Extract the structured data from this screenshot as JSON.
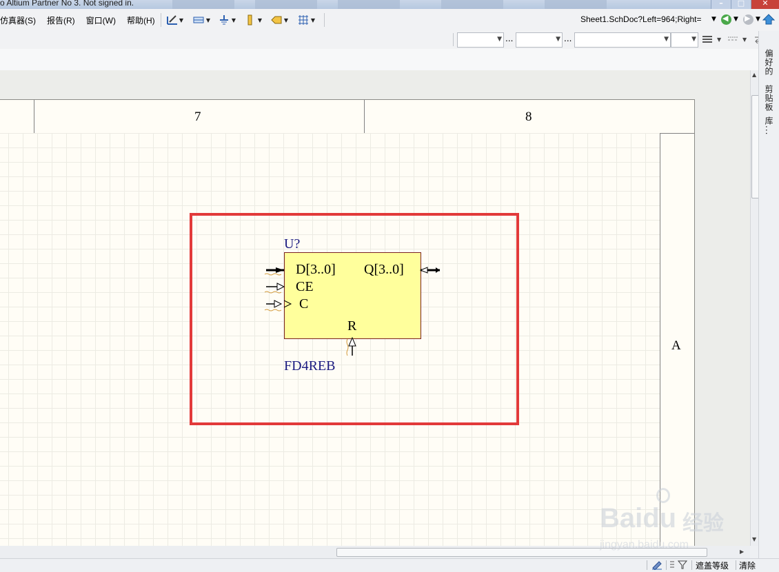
{
  "window": {
    "title": "o Altium Partner No 3. Not signed in."
  },
  "menu": {
    "items": [
      "仿真器(S)",
      "报告(R)",
      "窗口(W)",
      "帮助(H)"
    ]
  },
  "toolbar": {
    "icons": [
      "wire-pen-icon",
      "bus-icon",
      "ground-icon",
      "pin-icon",
      "port-icon",
      "grid-icon"
    ],
    "address": "Sheet1.SchDoc?Left=964;Right="
  },
  "toolbar2": {
    "combo_values": [
      "",
      "",
      "",
      ""
    ],
    "ellipsis": "..."
  },
  "sheet": {
    "zone_columns": [
      "7",
      "8"
    ],
    "zone_row": "A"
  },
  "component": {
    "designator": "U?",
    "comment": "FD4REB",
    "pins": {
      "d": "D[3..0]",
      "ce": "CE",
      "c": "C",
      "q": "Q[3..0]",
      "r": "R"
    }
  },
  "right_panel": {
    "tabs": [
      "偏好的",
      "剪贴板",
      "库..."
    ]
  },
  "status_bar": {
    "mask_level": "遮盖等级",
    "clear": "清除"
  },
  "watermark": {
    "brand": "Bai",
    "brand2": "du",
    "cn": "经验",
    "url": "jingyan.baidu.com"
  },
  "colors": {
    "highlight_box": "#e23a3a",
    "component_fill": "#ffff9c",
    "designator_text": "#1a1a80",
    "sheet_background": "#fffdf6"
  }
}
